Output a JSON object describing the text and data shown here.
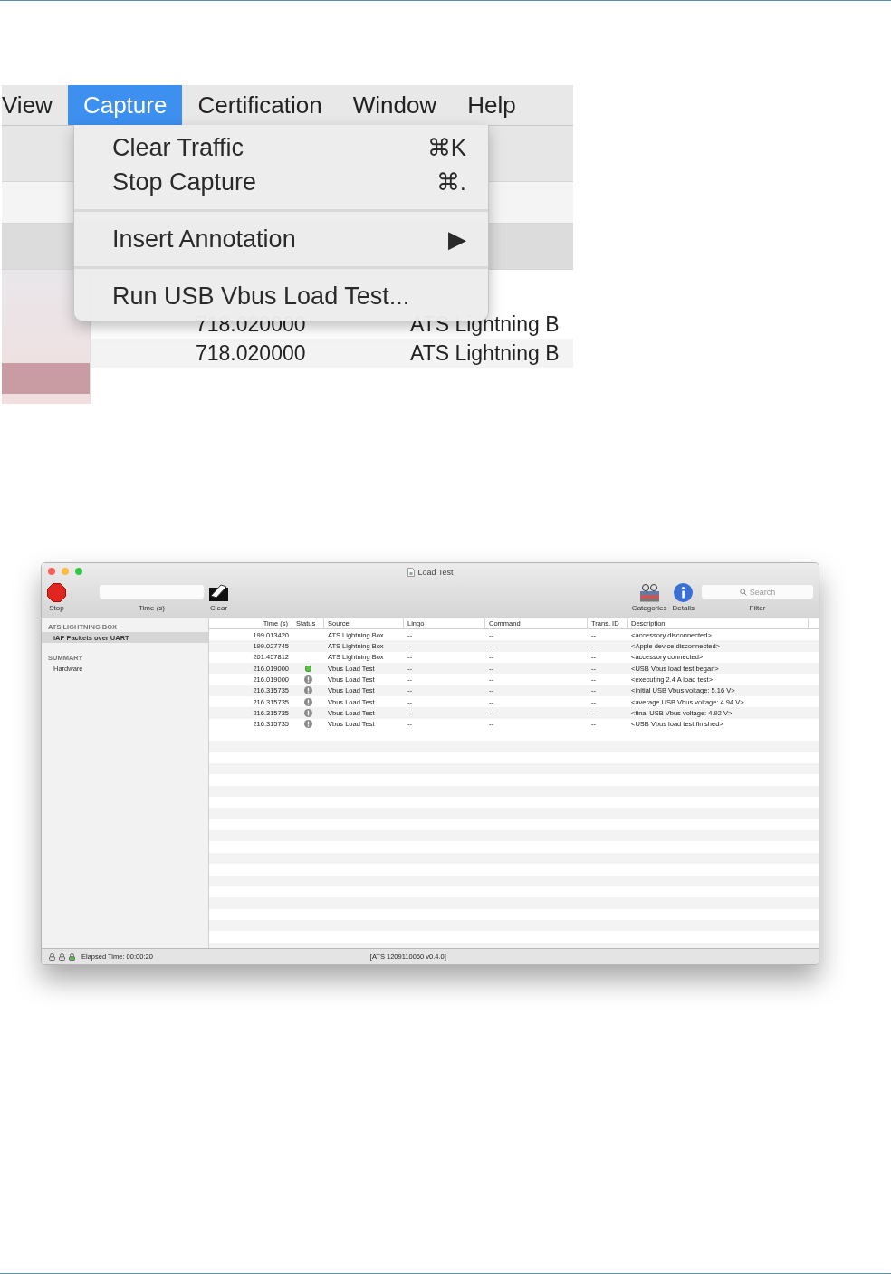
{
  "menu_screenshot": {
    "menubar": [
      {
        "label": "View",
        "selected": false
      },
      {
        "label": "Capture",
        "selected": true
      },
      {
        "label": "Certification",
        "selected": false
      },
      {
        "label": "Window",
        "selected": false
      },
      {
        "label": "Help",
        "selected": false
      }
    ],
    "menu": [
      {
        "kind": "item",
        "label": "Clear Traffic",
        "shortcut": "⌘K"
      },
      {
        "kind": "item",
        "label": "Stop Capture",
        "shortcut": "⌘."
      },
      {
        "kind": "separator"
      },
      {
        "kind": "submenu",
        "label": "Insert Annotation",
        "arrow": "▶"
      },
      {
        "kind": "separator"
      },
      {
        "kind": "item",
        "label": "Run USB Vbus Load Test..."
      }
    ],
    "rows": [
      {
        "time": "718.020000",
        "source": "ATS Lightning B"
      },
      {
        "time": "718.020000",
        "source": "ATS Lightning B"
      }
    ]
  },
  "window": {
    "title": "Load Test",
    "toolbar": {
      "stop_label": "Stop",
      "time_label": "Time (s)",
      "clear_label": "Clear",
      "categories_label": "Categories",
      "details_label": "Details",
      "search_placeholder": "Search",
      "filter_label": "Filter"
    },
    "sidebar": [
      {
        "header": "ATS LIGHTNING BOX",
        "items": [
          {
            "label": "iAP Packets over UART",
            "selected": true
          }
        ]
      },
      {
        "header": "SUMMARY",
        "items": [
          {
            "label": "Hardware",
            "selected": false
          }
        ]
      }
    ],
    "columns": [
      "Time (s)",
      "Status",
      "Source",
      "Lingo",
      "Command",
      "Trans. ID",
      "Description"
    ],
    "rows": [
      {
        "time": "199.013420",
        "kind": "plain",
        "source": "ATS Lightning Box",
        "lingo": "--",
        "command": "--",
        "trans_id": "--",
        "description": "<accessory disconnected>"
      },
      {
        "time": "199.027745",
        "kind": "plain",
        "source": "ATS Lightning Box",
        "lingo": "--",
        "command": "--",
        "trans_id": "--",
        "description": "<Apple device disconnected>"
      },
      {
        "time": "201.457812",
        "kind": "plain",
        "source": "ATS Lightning Box",
        "lingo": "--",
        "command": "--",
        "trans_id": "--",
        "description": "<accessory connected>"
      },
      {
        "time": "216.019000",
        "kind": "ok",
        "source": "Vbus Load Test",
        "lingo": "--",
        "command": "--",
        "trans_id": "--",
        "description": "<USB Vbus load test began>"
      },
      {
        "time": "216.019000",
        "kind": "alert",
        "source": "Vbus Load Test",
        "lingo": "--",
        "command": "--",
        "trans_id": "--",
        "description": "<executing 2.4 A load test>"
      },
      {
        "time": "216.315735",
        "kind": "alert",
        "source": "Vbus Load Test",
        "lingo": "--",
        "command": "--",
        "trans_id": "--",
        "description": "<initial USB Vbus voltage: 5.16 V>"
      },
      {
        "time": "216.315735",
        "kind": "alert",
        "source": "Vbus Load Test",
        "lingo": "--",
        "command": "--",
        "trans_id": "--",
        "description": "<average USB Vbus voltage: 4.94 V>"
      },
      {
        "time": "216.315735",
        "kind": "alert",
        "source": "Vbus Load Test",
        "lingo": "--",
        "command": "--",
        "trans_id": "--",
        "description": "<final USB Vbus voltage: 4.92 V>"
      },
      {
        "time": "216.315735",
        "kind": "alert",
        "source": "Vbus Load Test",
        "lingo": "--",
        "command": "--",
        "trans_id": "--",
        "description": "<USB Vbus load test finished>"
      }
    ],
    "status_bar": {
      "lights": [
        {
          "on": false
        },
        {
          "on": false
        },
        {
          "on": true
        }
      ],
      "elapsed": "Elapsed Time: 00:00:20",
      "version": "[ATS 1209110060 v0.4.0]"
    }
  }
}
